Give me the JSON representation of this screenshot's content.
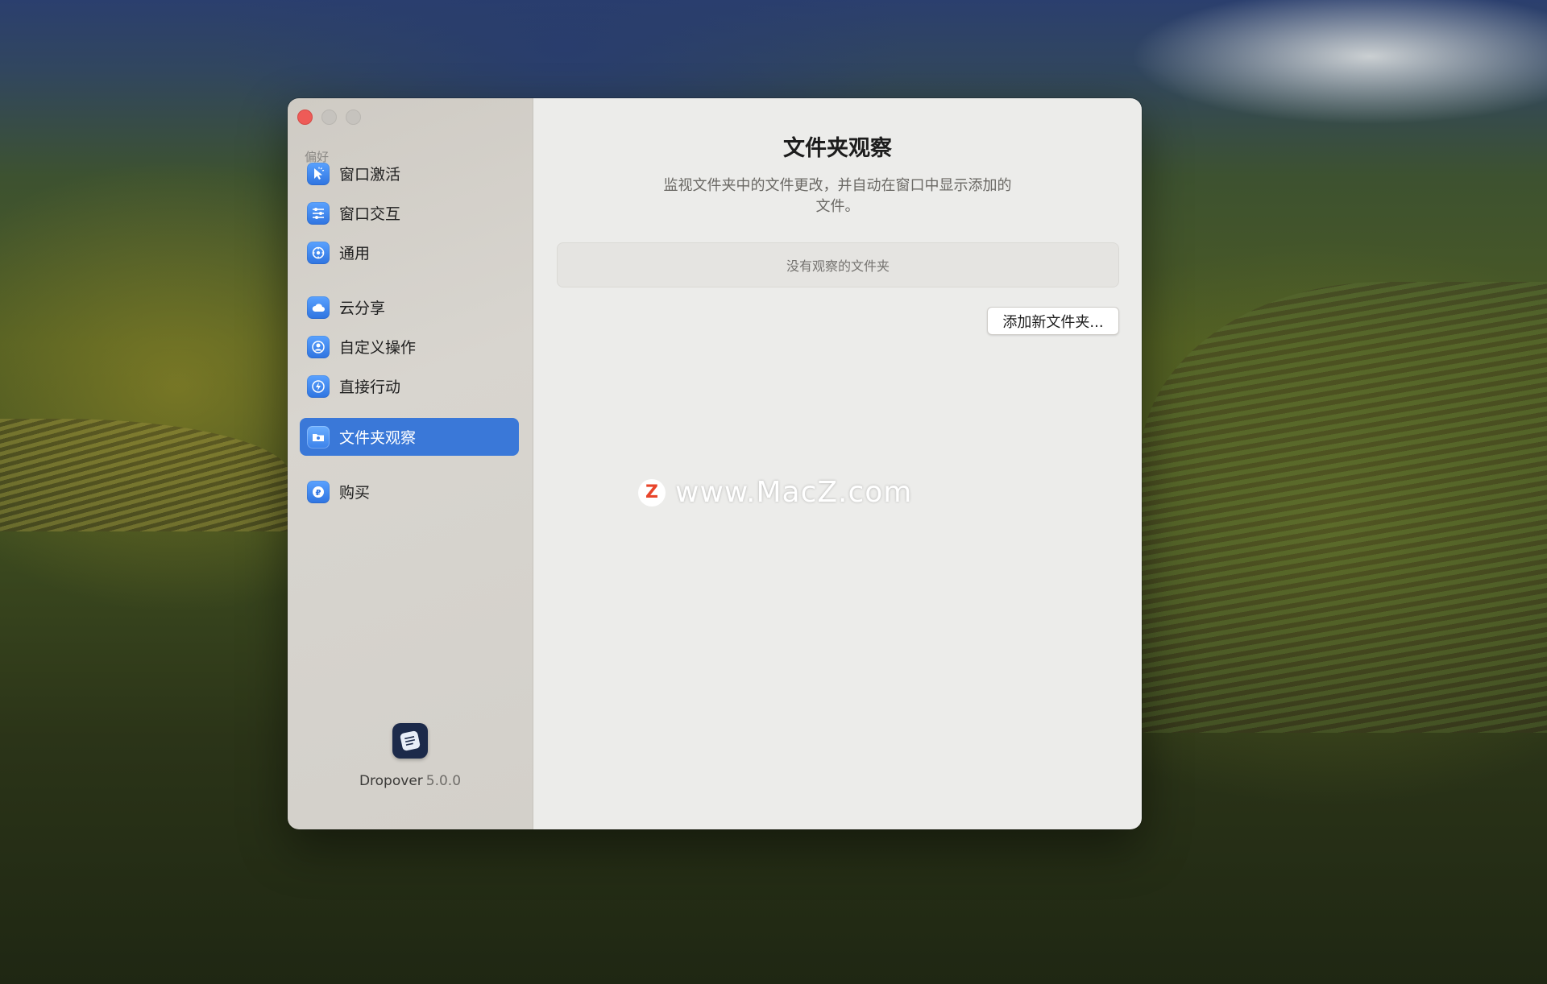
{
  "sidebar": {
    "section_title": "偏好",
    "items": [
      {
        "label": "窗口激活",
        "icon": "cursor-pointer-icon"
      },
      {
        "label": "窗口交互",
        "icon": "sliders-icon"
      },
      {
        "label": "通用",
        "icon": "gear-icon"
      },
      {
        "label": "云分享",
        "icon": "cloud-icon"
      },
      {
        "label": "自定义操作",
        "icon": "person-icon"
      },
      {
        "label": "直接行动",
        "icon": "lightning-icon"
      },
      {
        "label": "文件夹观察",
        "icon": "folder-eye-icon",
        "active": true
      },
      {
        "label": "购买",
        "icon": "coin-icon"
      }
    ],
    "app_name": "Dropover",
    "app_version": "5.0.0"
  },
  "main": {
    "title": "文件夹观察",
    "description": "监视文件夹中的文件更改，并自动在窗口中显示添加的文件。",
    "empty_state": "没有观察的文件夹",
    "add_button": "添加新文件夹..."
  },
  "watermark": {
    "logo_letter": "Z",
    "text": "www.MacZ.com"
  },
  "colors": {
    "accent": "#3a78d8",
    "close_button": "#ee5b57"
  }
}
